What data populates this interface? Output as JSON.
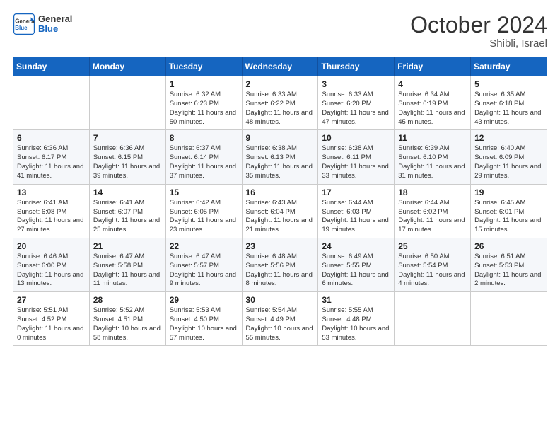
{
  "header": {
    "logo_general": "General",
    "logo_blue": "Blue",
    "month": "October 2024",
    "location": "Shibli, Israel"
  },
  "days_of_week": [
    "Sunday",
    "Monday",
    "Tuesday",
    "Wednesday",
    "Thursday",
    "Friday",
    "Saturday"
  ],
  "weeks": [
    [
      {
        "day": "",
        "info": ""
      },
      {
        "day": "",
        "info": ""
      },
      {
        "day": "1",
        "info": "Sunrise: 6:32 AM\nSunset: 6:23 PM\nDaylight: 11 hours and 50 minutes."
      },
      {
        "day": "2",
        "info": "Sunrise: 6:33 AM\nSunset: 6:22 PM\nDaylight: 11 hours and 48 minutes."
      },
      {
        "day": "3",
        "info": "Sunrise: 6:33 AM\nSunset: 6:20 PM\nDaylight: 11 hours and 47 minutes."
      },
      {
        "day": "4",
        "info": "Sunrise: 6:34 AM\nSunset: 6:19 PM\nDaylight: 11 hours and 45 minutes."
      },
      {
        "day": "5",
        "info": "Sunrise: 6:35 AM\nSunset: 6:18 PM\nDaylight: 11 hours and 43 minutes."
      }
    ],
    [
      {
        "day": "6",
        "info": "Sunrise: 6:36 AM\nSunset: 6:17 PM\nDaylight: 11 hours and 41 minutes."
      },
      {
        "day": "7",
        "info": "Sunrise: 6:36 AM\nSunset: 6:15 PM\nDaylight: 11 hours and 39 minutes."
      },
      {
        "day": "8",
        "info": "Sunrise: 6:37 AM\nSunset: 6:14 PM\nDaylight: 11 hours and 37 minutes."
      },
      {
        "day": "9",
        "info": "Sunrise: 6:38 AM\nSunset: 6:13 PM\nDaylight: 11 hours and 35 minutes."
      },
      {
        "day": "10",
        "info": "Sunrise: 6:38 AM\nSunset: 6:11 PM\nDaylight: 11 hours and 33 minutes."
      },
      {
        "day": "11",
        "info": "Sunrise: 6:39 AM\nSunset: 6:10 PM\nDaylight: 11 hours and 31 minutes."
      },
      {
        "day": "12",
        "info": "Sunrise: 6:40 AM\nSunset: 6:09 PM\nDaylight: 11 hours and 29 minutes."
      }
    ],
    [
      {
        "day": "13",
        "info": "Sunrise: 6:41 AM\nSunset: 6:08 PM\nDaylight: 11 hours and 27 minutes."
      },
      {
        "day": "14",
        "info": "Sunrise: 6:41 AM\nSunset: 6:07 PM\nDaylight: 11 hours and 25 minutes."
      },
      {
        "day": "15",
        "info": "Sunrise: 6:42 AM\nSunset: 6:05 PM\nDaylight: 11 hours and 23 minutes."
      },
      {
        "day": "16",
        "info": "Sunrise: 6:43 AM\nSunset: 6:04 PM\nDaylight: 11 hours and 21 minutes."
      },
      {
        "day": "17",
        "info": "Sunrise: 6:44 AM\nSunset: 6:03 PM\nDaylight: 11 hours and 19 minutes."
      },
      {
        "day": "18",
        "info": "Sunrise: 6:44 AM\nSunset: 6:02 PM\nDaylight: 11 hours and 17 minutes."
      },
      {
        "day": "19",
        "info": "Sunrise: 6:45 AM\nSunset: 6:01 PM\nDaylight: 11 hours and 15 minutes."
      }
    ],
    [
      {
        "day": "20",
        "info": "Sunrise: 6:46 AM\nSunset: 6:00 PM\nDaylight: 11 hours and 13 minutes."
      },
      {
        "day": "21",
        "info": "Sunrise: 6:47 AM\nSunset: 5:58 PM\nDaylight: 11 hours and 11 minutes."
      },
      {
        "day": "22",
        "info": "Sunrise: 6:47 AM\nSunset: 5:57 PM\nDaylight: 11 hours and 9 minutes."
      },
      {
        "day": "23",
        "info": "Sunrise: 6:48 AM\nSunset: 5:56 PM\nDaylight: 11 hours and 8 minutes."
      },
      {
        "day": "24",
        "info": "Sunrise: 6:49 AM\nSunset: 5:55 PM\nDaylight: 11 hours and 6 minutes."
      },
      {
        "day": "25",
        "info": "Sunrise: 6:50 AM\nSunset: 5:54 PM\nDaylight: 11 hours and 4 minutes."
      },
      {
        "day": "26",
        "info": "Sunrise: 6:51 AM\nSunset: 5:53 PM\nDaylight: 11 hours and 2 minutes."
      }
    ],
    [
      {
        "day": "27",
        "info": "Sunrise: 5:51 AM\nSunset: 4:52 PM\nDaylight: 11 hours and 0 minutes."
      },
      {
        "day": "28",
        "info": "Sunrise: 5:52 AM\nSunset: 4:51 PM\nDaylight: 10 hours and 58 minutes."
      },
      {
        "day": "29",
        "info": "Sunrise: 5:53 AM\nSunset: 4:50 PM\nDaylight: 10 hours and 57 minutes."
      },
      {
        "day": "30",
        "info": "Sunrise: 5:54 AM\nSunset: 4:49 PM\nDaylight: 10 hours and 55 minutes."
      },
      {
        "day": "31",
        "info": "Sunrise: 5:55 AM\nSunset: 4:48 PM\nDaylight: 10 hours and 53 minutes."
      },
      {
        "day": "",
        "info": ""
      },
      {
        "day": "",
        "info": ""
      }
    ]
  ]
}
